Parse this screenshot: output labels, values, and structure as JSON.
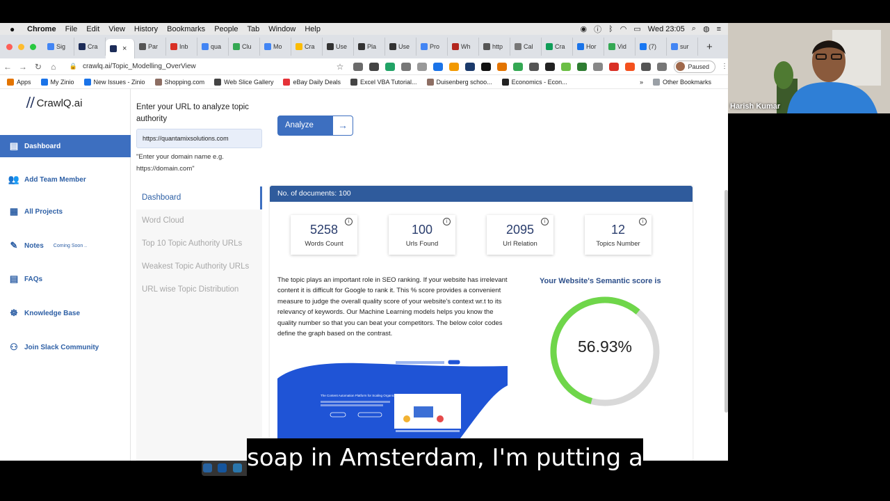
{
  "menubar": {
    "app": "Chrome",
    "items": [
      "File",
      "Edit",
      "View",
      "History",
      "Bookmarks",
      "People",
      "Tab",
      "Window",
      "Help"
    ],
    "clock": "Wed 23:05"
  },
  "tabs": [
    {
      "label": "Sig",
      "color": "#4285f4"
    },
    {
      "label": "Cra",
      "color": "#1c2c58"
    },
    {
      "label": "",
      "color": "#1c2c58"
    },
    {
      "label": "Par",
      "color": "#555555"
    },
    {
      "label": "Inb",
      "color": "#d93025"
    },
    {
      "label": "qua",
      "color": "#4285f4"
    },
    {
      "label": "Clu",
      "color": "#34a853"
    },
    {
      "label": "Mo",
      "color": "#4285f4"
    },
    {
      "label": "Cra",
      "color": "#fbbc04"
    },
    {
      "label": "Use",
      "color": "#333333"
    },
    {
      "label": "Pla",
      "color": "#333333"
    },
    {
      "label": "Use",
      "color": "#333333"
    },
    {
      "label": "Pro",
      "color": "#4285f4"
    },
    {
      "label": "Wh",
      "color": "#b3261e"
    },
    {
      "label": "http",
      "color": "#555555"
    },
    {
      "label": "Cal",
      "color": "#777777"
    },
    {
      "label": "Cra",
      "color": "#0f9d58"
    },
    {
      "label": "Hor",
      "color": "#1a73e8"
    },
    {
      "label": "Vid",
      "color": "#34a853"
    },
    {
      "label": "(7)",
      "color": "#1877f2"
    },
    {
      "label": "sur",
      "color": "#4285f4"
    }
  ],
  "address": {
    "url": "crawlq.ai/Topic_Modelling_OverView",
    "profile_status": "Paused"
  },
  "bookmarks": [
    {
      "label": "Apps",
      "color": "#e37400"
    },
    {
      "label": "My Zinio",
      "color": "#1a73e8"
    },
    {
      "label": "New Issues - Zinio",
      "color": "#1a73e8"
    },
    {
      "label": "Shopping.com",
      "color": "#8d6e63"
    },
    {
      "label": "Web Slice Gallery",
      "color": "#444444"
    },
    {
      "label": "eBay Daily Deals",
      "color": "#e53238"
    },
    {
      "label": "Excel VBA Tutorial...",
      "color": "#444444"
    },
    {
      "label": "Duisenberg schoo...",
      "color": "#8d6e63"
    },
    {
      "label": "Economics - Econ...",
      "color": "#222222"
    }
  ],
  "bookmarks_more": "»",
  "other_bookmarks": "Other Bookmarks",
  "brand": {
    "name": "CrawlQ.ai"
  },
  "sidebar": [
    {
      "label": "Dashboard",
      "icon": "dashboard-icon",
      "glyph": "▤",
      "active": true
    },
    {
      "label": "Add Team Member",
      "icon": "team-icon",
      "glyph": "👥",
      "active": false
    },
    {
      "label": "All Projects",
      "icon": "projects-icon",
      "glyph": "▦",
      "active": false
    },
    {
      "label": "Notes",
      "icon": "notes-icon",
      "glyph": "✎",
      "active": false,
      "badge": "Coming Soon .."
    },
    {
      "label": "FAQs",
      "icon": "faq-icon",
      "glyph": "▤",
      "active": false
    },
    {
      "label": "Knowledge Base",
      "icon": "knowledge-icon",
      "glyph": "☸",
      "active": false
    },
    {
      "label": "Join Slack Community",
      "icon": "slack-icon",
      "glyph": "⚇",
      "active": false
    }
  ],
  "url_form": {
    "label": "Enter your URL to analyze topic authority",
    "value": "https://quantamixsolutions.com",
    "hint": "\"Enter your domain name e.g. https://domain.com\"",
    "analyze_label": "Analyze"
  },
  "submenu": [
    {
      "label": "Dashboard",
      "active": true
    },
    {
      "label": "Word Cloud",
      "active": false
    },
    {
      "label": "Top 10 Topic Authority URLs",
      "active": false
    },
    {
      "label": "Weakest Topic Authority URLs",
      "active": false
    },
    {
      "label": "URL wise Topic Distribution",
      "active": false
    }
  ],
  "panel": {
    "header": "No. of documents: 100",
    "stats": [
      {
        "value": "5258",
        "label": "Words Count"
      },
      {
        "value": "100",
        "label": "Urls Found"
      },
      {
        "value": "2095",
        "label": "Url Relation"
      },
      {
        "value": "12",
        "label": "Topics Number"
      }
    ],
    "description": "The topic plays an important role in SEO ranking. If your website has irrelevant content it is difficult for Google to rank it. This % score provides a convenient measure to judge the overall quality score of your website's context wr.t to its relevancy of keywords. Our Machine Learning models helps you know the quality number so that you can beat your competitors. The below color codes define the graph based on the contrast.",
    "score_title": "Your Website's Semantic score is",
    "score_text": "56.93%",
    "score_fraction": 0.5693,
    "gauge_color": "#6fd64a",
    "gauge_track": "#d9d9d9"
  },
  "preview": {
    "headline": "The Content Automation Platform for Scaling Organically",
    "badge": "Get started"
  },
  "webcam": {
    "name": "Harish Kumar"
  },
  "caption": "soap in Amsterdam, I'm putting a"
}
